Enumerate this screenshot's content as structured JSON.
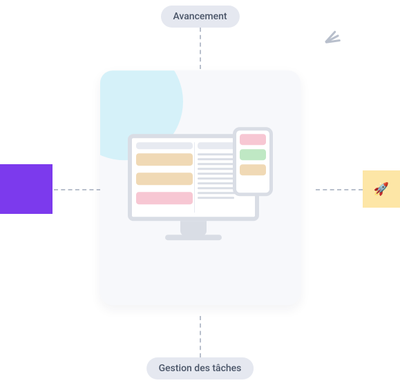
{
  "labels": {
    "top": "Avancement",
    "bottom": "Gestion des tâches"
  },
  "icons": {
    "rocket": "🚀"
  },
  "colors": {
    "purple": "#7c3aed",
    "yellow": "#fde6a6",
    "blob": "#d5f1f9",
    "tan": "#f0d9b5",
    "pink": "#f7c7d3",
    "green": "#bfe8c4"
  }
}
